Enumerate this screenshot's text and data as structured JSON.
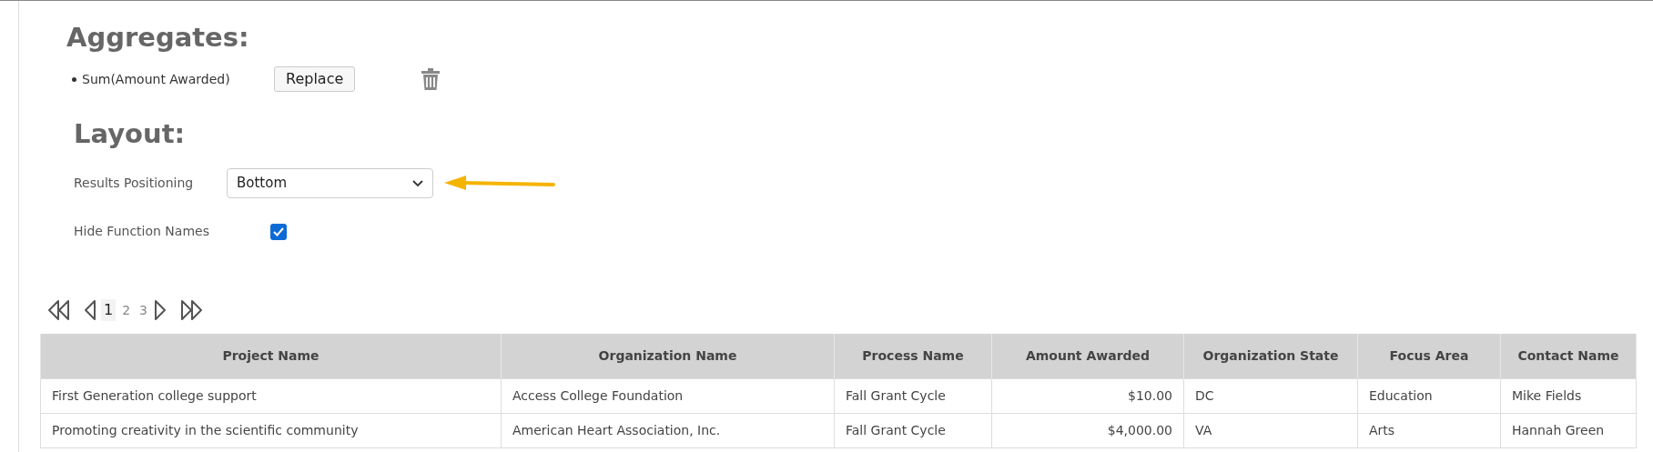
{
  "aggregates": {
    "title": "Aggregates:",
    "items": [
      {
        "label": "Sum(Amount Awarded)",
        "button": "Replace"
      }
    ]
  },
  "layout": {
    "title": "Layout:",
    "results_positioning": {
      "label": "Results Positioning",
      "value": "Bottom"
    },
    "hide_function_names": {
      "label": "Hide Function Names",
      "checked": true
    }
  },
  "pager": {
    "pages": [
      {
        "label": "1",
        "selected": true
      },
      {
        "label": "2",
        "selected": false
      },
      {
        "label": "3",
        "selected": false
      }
    ]
  },
  "table": {
    "columns": [
      {
        "label": "Project Name",
        "right_aligned": false
      },
      {
        "label": "Organization Name",
        "right_aligned": false
      },
      {
        "label": "Process Name",
        "right_aligned": false
      },
      {
        "label": "Amount Awarded",
        "right_aligned": true
      },
      {
        "label": "Organization State",
        "right_aligned": false
      },
      {
        "label": "Focus Area",
        "right_aligned": false
      },
      {
        "label": "Contact Name",
        "right_aligned": false
      }
    ],
    "rows": [
      [
        "First Generation college support",
        "Access College Foundation",
        "Fall Grant Cycle",
        "$10.00",
        "DC",
        "Education",
        "Mike Fields"
      ],
      [
        "Promoting creativity in the scientific community",
        "American Heart Association, Inc.",
        "Fall Grant Cycle",
        "$4,000.00",
        "VA",
        "Arts",
        "Hannah Green"
      ]
    ]
  }
}
